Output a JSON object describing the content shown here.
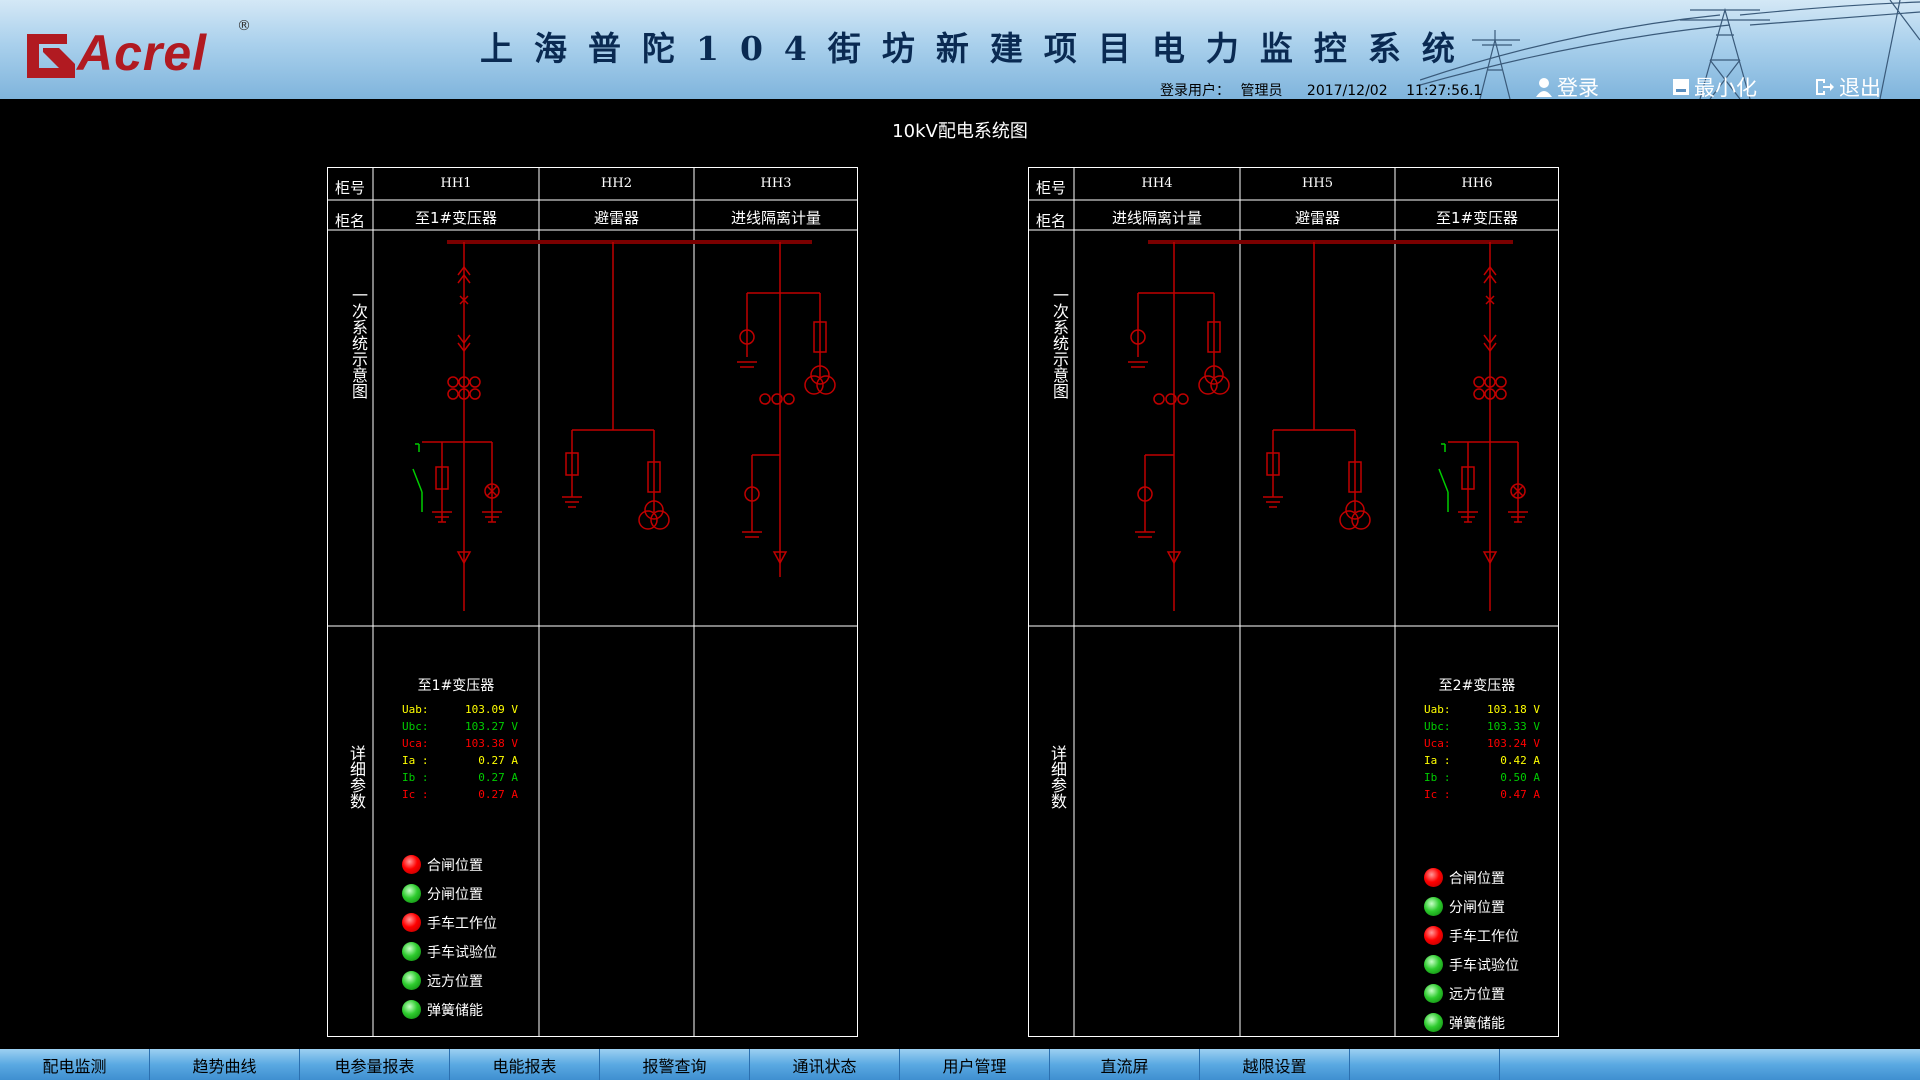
{
  "header": {
    "logo_text": "Acrel",
    "logo_mark": "®",
    "title": "上海普陀104街坊新建项目电力监控系统",
    "login_user_label": "登录用户：",
    "login_user": "管理员",
    "date": "2017/12/02",
    "time": "11:27:56.1",
    "buttons": {
      "login": "登录",
      "minimize": "最小化",
      "logout": "退出"
    }
  },
  "page_title": "10kV配电系统图",
  "row_labels": {
    "cabinet_no": "柜号",
    "cabinet_name": "柜名",
    "primary": "一次系统示意图",
    "details": "详细参数"
  },
  "panels": [
    {
      "cabinets": [
        {
          "no": "HH1",
          "name": "至1#变压器"
        },
        {
          "no": "HH2",
          "name": "避雷器"
        },
        {
          "no": "HH3",
          "name": "进线隔离计量"
        }
      ],
      "detail": {
        "name": "至1#变压器",
        "params": [
          {
            "k": "Uab:",
            "v": "103.09 V",
            "color": "#ffff00"
          },
          {
            "k": "Ubc:",
            "v": "103.27 V",
            "color": "#00cc00"
          },
          {
            "k": "Uca:",
            "v": "103.38 V",
            "color": "#ff0000"
          },
          {
            "k": "Ia :",
            "v": "0.27  A",
            "color": "#ffff00"
          },
          {
            "k": "Ib :",
            "v": "0.27  A",
            "color": "#00cc00"
          },
          {
            "k": "Ic :",
            "v": "0.27  A",
            "color": "#ff0000"
          }
        ],
        "status": [
          {
            "label": "合闸位置",
            "state": "red"
          },
          {
            "label": "分闸位置",
            "state": "green"
          },
          {
            "label": "手车工作位",
            "state": "red"
          },
          {
            "label": "手车试验位",
            "state": "green"
          },
          {
            "label": "远方位置",
            "state": "green"
          },
          {
            "label": "弹簧储能",
            "state": "green"
          }
        ]
      }
    },
    {
      "cabinets": [
        {
          "no": "HH4",
          "name": "进线隔离计量"
        },
        {
          "no": "HH5",
          "name": "避雷器"
        },
        {
          "no": "HH6",
          "name": "至1#变压器"
        }
      ],
      "detail": {
        "name": "至2#变压器",
        "params": [
          {
            "k": "Uab:",
            "v": "103.18 V",
            "color": "#ffff00"
          },
          {
            "k": "Ubc:",
            "v": "103.33 V",
            "color": "#00cc00"
          },
          {
            "k": "Uca:",
            "v": "103.24 V",
            "color": "#ff0000"
          },
          {
            "k": "Ia :",
            "v": "0.42  A",
            "color": "#ffff00"
          },
          {
            "k": "Ib :",
            "v": "0.50  A",
            "color": "#00cc00"
          },
          {
            "k": "Ic :",
            "v": "0.47  A",
            "color": "#ff0000"
          }
        ],
        "status": [
          {
            "label": "合闸位置",
            "state": "red"
          },
          {
            "label": "分闸位置",
            "state": "green"
          },
          {
            "label": "手车工作位",
            "state": "red"
          },
          {
            "label": "手车试验位",
            "state": "green"
          },
          {
            "label": "远方位置",
            "state": "green"
          },
          {
            "label": "弹簧储能",
            "state": "green"
          }
        ]
      }
    }
  ],
  "nav": [
    "配电监测",
    "趋势曲线",
    "电参量报表",
    "电能报表",
    "报警查询",
    "通讯状态",
    "用户管理",
    "直流屏",
    "越限设置",
    ""
  ],
  "colors": {
    "line": "#c00000",
    "busbar": "#7a0000",
    "grid": "#ffffff",
    "ground_green": "#00cc00"
  }
}
